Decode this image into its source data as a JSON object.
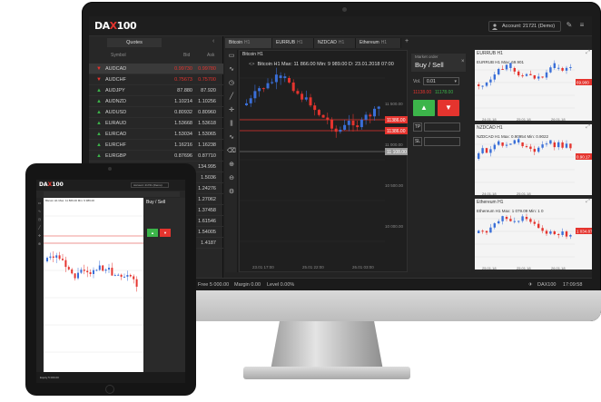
{
  "desktop": {
    "logo": {
      "prefix": "DA",
      "x": "X",
      "suffix": "100"
    },
    "account_label": "Account: 21721 (Demo)",
    "quotes_tab": "Quotes",
    "quotes_headers": {
      "symbol": "Symbol",
      "bid": "Bid",
      "ask": "Ask"
    },
    "quotes": [
      {
        "symbol": "AUDCAD",
        "bid": "0.99730",
        "ask": "0.99780",
        "dir": "down"
      },
      {
        "symbol": "AUDCHF",
        "bid": "0.75673",
        "ask": "0.75700",
        "dir": "down"
      },
      {
        "symbol": "AUDJPY",
        "bid": "87.880",
        "ask": "87.920",
        "dir": "up"
      },
      {
        "symbol": "AUDNZD",
        "bid": "1.10214",
        "ask": "1.10256",
        "dir": "up"
      },
      {
        "symbol": "AUDUSD",
        "bid": "0.80932",
        "ask": "0.80960",
        "dir": "up"
      },
      {
        "symbol": "EURAUD",
        "bid": "1.53668",
        "ask": "1.53618",
        "dir": "up"
      },
      {
        "symbol": "EURCAD",
        "bid": "1.53034",
        "ask": "1.53065",
        "dir": "up"
      },
      {
        "symbol": "EURCHF",
        "bid": "1.16216",
        "ask": "1.16238",
        "dir": "up"
      },
      {
        "symbol": "EURGBP",
        "bid": "0.87696",
        "ask": "0.87710",
        "dir": "up"
      },
      {
        "symbol": "",
        "bid": "",
        "ask": "134.995",
        "dir": "none"
      },
      {
        "symbol": "",
        "bid": "",
        "ask": "1.5036",
        "dir": "none"
      },
      {
        "symbol": "",
        "bid": "",
        "ask": "1.24276",
        "dir": "none"
      },
      {
        "symbol": "",
        "bid": "",
        "ask": "1.27062",
        "dir": "none"
      },
      {
        "symbol": "",
        "bid": "",
        "ask": "1.37458",
        "dir": "none"
      },
      {
        "symbol": "",
        "bid": "",
        "ask": "1.61546",
        "dir": "none"
      },
      {
        "symbol": "",
        "bid": "",
        "ask": "1.54005",
        "dir": "none"
      },
      {
        "symbol": "",
        "bid": "",
        "ask": "1.4187",
        "dir": "none"
      }
    ],
    "tabs": [
      {
        "label": "Bitcoin",
        "tf": "H1"
      },
      {
        "label": "EURRUB",
        "tf": "H1"
      },
      {
        "label": "NZDCAD",
        "tf": "H1"
      },
      {
        "label": "Ethereum",
        "tf": "H1"
      }
    ],
    "main_chart": {
      "panel_title": "Bitcoin H1",
      "info": "Bitcoin  H1  Max: 11 866.00  Min: 9 989.00  D: 23.01.2018 07:00",
      "price_labels": {
        "sell_line_1": "11386.00",
        "sell_line_2": "11386.00",
        "current": "11 108.00"
      },
      "x_labels": [
        "23.01 17:00",
        "25.01 22:00",
        "26.01 03:00"
      ],
      "y_labels": [
        "11 500.00",
        "11 000.00",
        "10 500.00",
        "10 000.00"
      ]
    },
    "order_panel": {
      "subtitle": "Market order",
      "title": "Buy / Sell",
      "vol_label": "Vol.",
      "vol_value": "0.01",
      "sell_price": "11138.00",
      "buy_price": "11178.00",
      "tp_label": "TP",
      "sl_label": "SL"
    },
    "small_charts": [
      {
        "title": "EURRUB H1",
        "info": "EURRUB  H1  Max: 69.901",
        "price": "69.900",
        "dates": [
          "24.01.18",
          "25.01.18",
          "26.01.18"
        ]
      },
      {
        "title": "NZDCAD H1",
        "info": "NZDCAD  H1  Max: 0.90954  Min: 0.9022",
        "price": "0.90.17",
        "dates": [
          "24.01.18",
          "25.01.18"
        ]
      },
      {
        "title": "Ethereum H1",
        "info": "Ethereum  H1  Max: 1 079.09  Min: 1 0",
        "price": "1 034.87",
        "dates": [
          "25.01.18",
          "25.01.18",
          "26.01.18"
        ]
      }
    ],
    "status": {
      "free": "Free  5 000.00",
      "margin": "Margin  0.00",
      "level": "Level  0.00%",
      "brand": "DAX100",
      "time": "17:09:58"
    }
  },
  "tablet": {
    "logo": {
      "prefix": "DA",
      "x": "X",
      "suffix": "100"
    },
    "account_label": "Account: 21721 (Demo)",
    "chart_info": "Bitcoin  H1  Max: 11 866.00  Min: 9 989.00",
    "panel_title": "Buy / Sell",
    "status": "Equity  5 000.00"
  },
  "colors": {
    "up": "#3cb54a",
    "down": "#e5342e",
    "blue": "#3a6fd8"
  }
}
